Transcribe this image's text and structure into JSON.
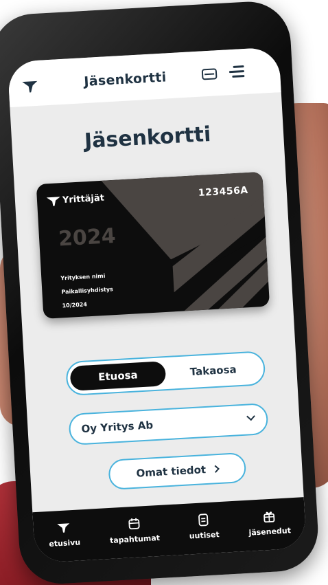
{
  "header": {
    "title": "Jäsenkortti",
    "logo_icon": "yrittajat-logo-icon",
    "card_icon": "card-icon",
    "menu_icon": "menu-icon"
  },
  "page": {
    "title": "Jäsenkortti"
  },
  "member_card": {
    "brand": "Yrittäjät",
    "number": "123456A",
    "year": "2024",
    "company_name": "Yrityksen nimi",
    "association": "Paikallisyhdistys",
    "valid_until": "10/2024"
  },
  "card_side_toggle": {
    "front_label": "Etuosa",
    "back_label": "Takaosa",
    "selected": "Etuosa"
  },
  "company_select": {
    "value": "Oy Yritys Ab"
  },
  "profile_link": {
    "label": "Omat tiedot"
  },
  "bottom_nav": {
    "items": [
      {
        "label": "etusivu",
        "icon": "home-logo-icon"
      },
      {
        "label": "tapahtumat",
        "icon": "calendar-icon"
      },
      {
        "label": "uutiset",
        "icon": "news-icon"
      },
      {
        "label": "jäsenedut",
        "icon": "gift-icon"
      }
    ]
  },
  "colors": {
    "accent": "#49b3dd",
    "text_dark": "#1f3242",
    "card_bg": "#0d0d0d",
    "card_stripe": "#4a4542",
    "screen_bg": "#ececec"
  }
}
